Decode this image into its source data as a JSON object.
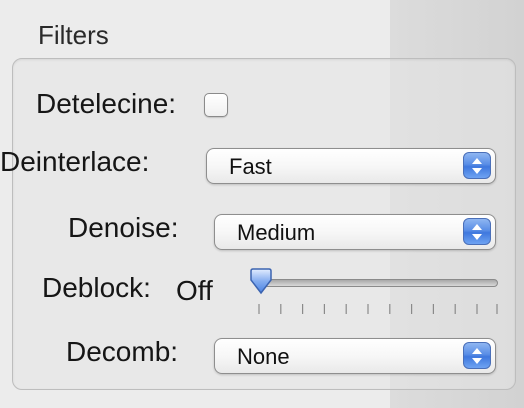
{
  "filters": {
    "title": "Filters",
    "detelecine": {
      "label": "Detelecine:",
      "checked": false
    },
    "deinterlace": {
      "label": "Deinterlace:",
      "value": "Fast"
    },
    "denoise": {
      "label": "Denoise:",
      "value": "Medium"
    },
    "deblock": {
      "label": "Deblock:",
      "value": "Off",
      "level": 0
    },
    "decomb": {
      "label": "Decomb:",
      "value": "None"
    }
  },
  "colors": {
    "accent": "#4a82e4"
  },
  "icons": {
    "popup_stepper": "up-down-arrows-icon"
  }
}
